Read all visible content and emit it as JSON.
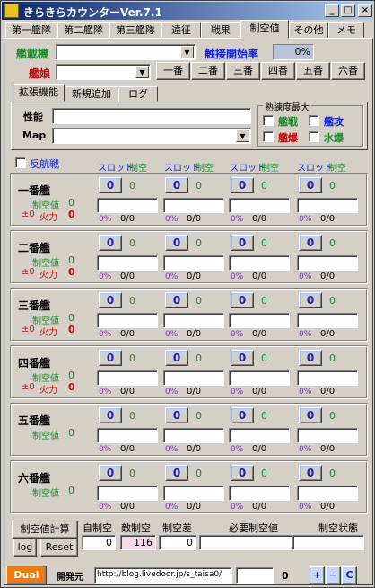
{
  "window": {
    "title": "きらきらカウンターVer.7.1",
    "min": "_",
    "max": "□",
    "close": "×"
  },
  "top_tabs": [
    "第一艦隊",
    "第二艦隊",
    "第三艦隊",
    "遠征",
    "戦果",
    "制空値",
    "その他",
    "メモ"
  ],
  "fleet": {
    "escort_label": "艦載機",
    "contact_label": "触接開始率",
    "contact_value": "0%",
    "ship_label": "艦娘",
    "ship_buttons": [
      "一番",
      "二番",
      "三番",
      "四番",
      "五番",
      "六番"
    ]
  },
  "sub_tabs": [
    "拡張機能",
    "新規追加",
    "ログ"
  ],
  "detail": {
    "stats_label": "性能",
    "map_label": "Map",
    "prof_group": "熟練度最大",
    "checks": [
      {
        "label": "艦戦",
        "color": "#1c8a2c"
      },
      {
        "label": "艦攻",
        "color": "#1020e0"
      },
      {
        "label": "艦爆",
        "color": "#d00000"
      },
      {
        "label": "水爆",
        "color": "#1c8a2c"
      }
    ]
  },
  "header": {
    "reverse_label": "反航戦",
    "slot_label": "スロット",
    "air_label": "制空"
  },
  "ships": [
    {
      "name": "一番艦",
      "air_label": "制空値",
      "air_value": "0",
      "pm": "±0",
      "fp_label": "火力",
      "fp_value": "0",
      "show_fp": true
    },
    {
      "name": "二番艦",
      "air_label": "制空値",
      "air_value": "0",
      "pm": "±0",
      "fp_label": "火力",
      "fp_value": "0",
      "show_fp": true
    },
    {
      "name": "三番艦",
      "air_label": "制空値",
      "air_value": "0",
      "pm": "±0",
      "fp_label": "火力",
      "fp_value": "0",
      "show_fp": true
    },
    {
      "name": "四番艦",
      "air_label": "制空値",
      "air_value": "0",
      "pm": "±0",
      "fp_label": "火力",
      "fp_value": "0",
      "show_fp": true
    },
    {
      "name": "五番艦",
      "air_label": "制空値",
      "air_value": "0",
      "pm": "",
      "fp_label": "",
      "fp_value": "",
      "show_fp": false
    },
    {
      "name": "六番艦",
      "air_label": "制空値",
      "air_value": "0",
      "pm": "",
      "fp_label": "",
      "fp_value": "",
      "show_fp": false
    }
  ],
  "slot": {
    "count": "0",
    "air": "0",
    "pct": "0%",
    "ratio": "0/0"
  },
  "bottom": {
    "calc_button": "制空値計算",
    "log_button": "log",
    "reset_button": "Reset",
    "own_air_label": "自制空",
    "own_air_value": "0",
    "enemy_air_label": "敵制空",
    "enemy_air_value": "116",
    "diff_label": "制空差",
    "diff_value": "0",
    "needed_label": "必要制空値",
    "needed_value": "",
    "state_label": "制空状態",
    "state_value": ""
  },
  "footer": {
    "dual_button": "Dual",
    "dev_label": "開発元",
    "url": "http://blog.livedoor.jp/s_taisa0/",
    "counter_value": "0",
    "plus": "+",
    "minus": "−",
    "c": "C"
  }
}
